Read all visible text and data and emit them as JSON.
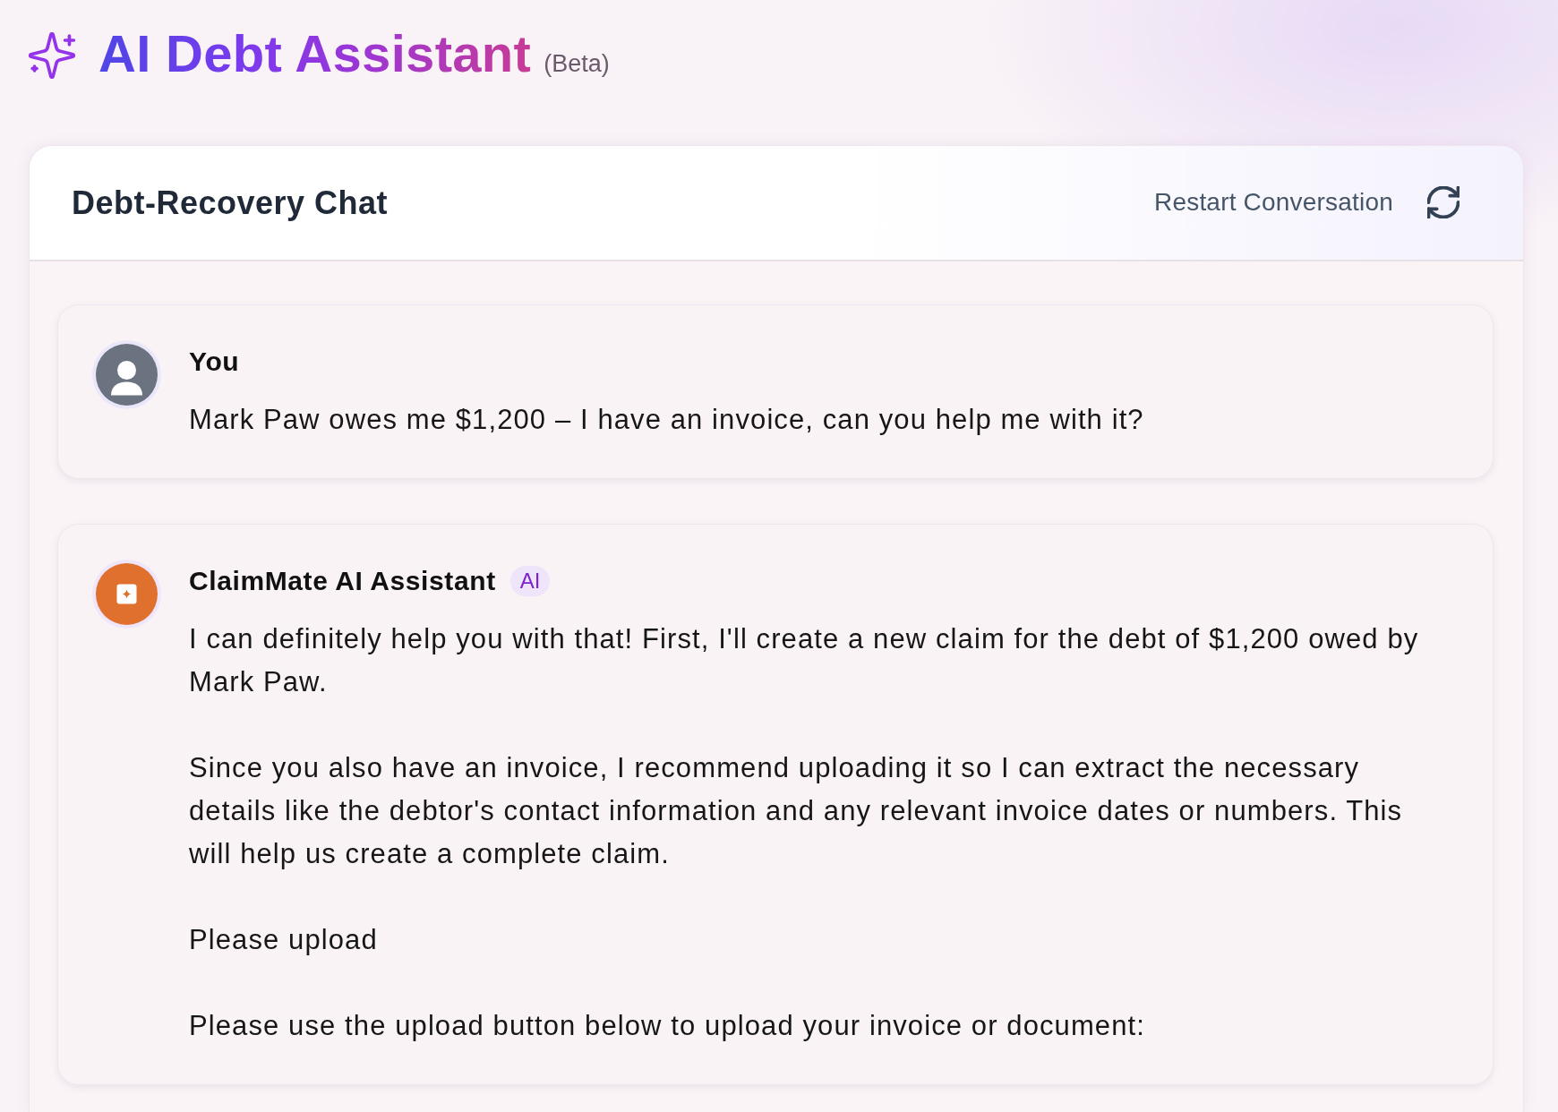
{
  "header": {
    "title": "AI Debt Assistant",
    "badge": "(Beta)"
  },
  "chat": {
    "title": "Debt-Recovery Chat",
    "restart_label": "Restart Conversation"
  },
  "messages": [
    {
      "kind": "user",
      "sender": "You",
      "paragraphs": [
        "Mark Paw owes me $1,200 – I have an invoice, can you help me with it?"
      ]
    },
    {
      "kind": "assistant",
      "sender": "ClaimMate AI Assistant",
      "tag": "AI",
      "paragraphs": [
        "I can definitely help you with that! First, I'll create a new claim for the debt of $1,200 owed by Mark Paw.",
        "Since you also have an invoice, I recommend uploading it so I can extract the necessary details like the debtor's contact information and any relevant invoice dates or numbers. This will help us create a complete claim.",
        "Please upload",
        "Please use the upload button below to upload your invoice or document:"
      ]
    }
  ]
}
